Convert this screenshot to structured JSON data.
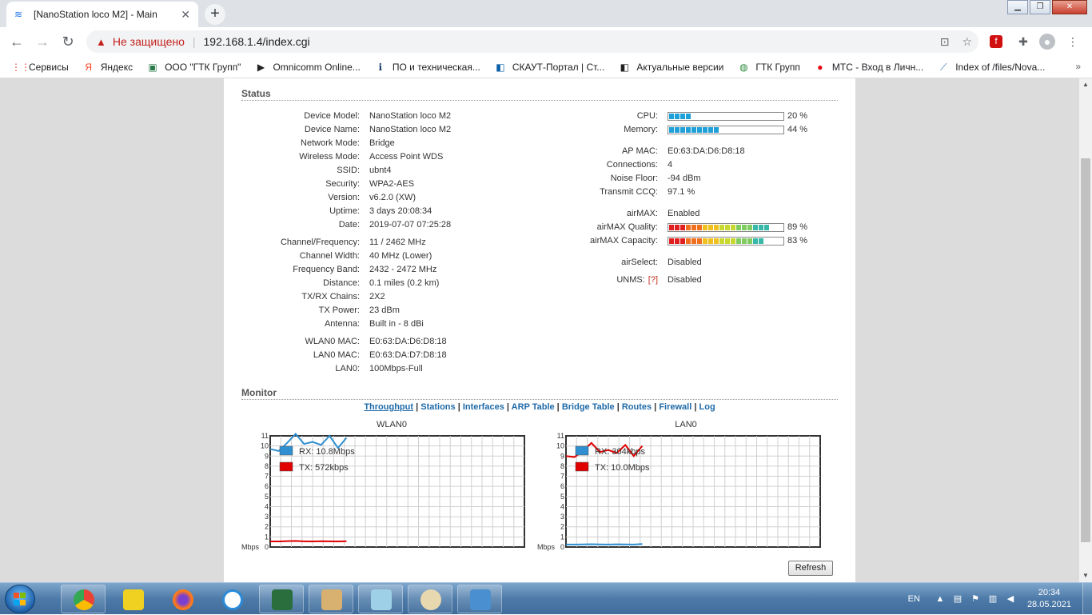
{
  "browser": {
    "tab_title": "[NanoStation loco M2] - Main",
    "tab_close": "✕",
    "new_tab": "+",
    "insecure_label": "Не защищено",
    "url": "192.168.1.4/index.cgi",
    "bookmarks": [
      {
        "label": "Сервисы",
        "icon": "apps-grid-icon",
        "glyph": "⋮⋮",
        "color": "#ea4335"
      },
      {
        "label": "Яндекс",
        "icon": "yandex-icon",
        "glyph": "Я",
        "color": "#fc3f1d"
      },
      {
        "label": "ООО \"ГТК Групп\"",
        "icon": "gtk-logo-icon",
        "glyph": "▣",
        "color": "#2b7a4b"
      },
      {
        "label": "Omnicomm Online...",
        "icon": "omnicomm-icon",
        "glyph": "▶",
        "color": "#222222"
      },
      {
        "label": "ПО и техническая...",
        "icon": "info-icon",
        "glyph": "ℹ",
        "color": "#1a3a6b"
      },
      {
        "label": "СКАУТ-Портал | Ст...",
        "icon": "scout-icon",
        "glyph": "◧",
        "color": "#0b5fa8"
      },
      {
        "label": "Актуальные версии",
        "icon": "versions-icon",
        "glyph": "◧",
        "color": "#222222"
      },
      {
        "label": "ГТК Групп",
        "icon": "gtk-group-icon",
        "glyph": "◍",
        "color": "#2c8a3e"
      },
      {
        "label": "МТС - Вход в Личн...",
        "icon": "mts-icon",
        "glyph": "●",
        "color": "#e30611"
      },
      {
        "label": "Index of /files/Nova...",
        "icon": "nova-icon",
        "glyph": "⟋",
        "color": "#3a6fb0"
      }
    ],
    "bookmarks_more": "»"
  },
  "status": {
    "title": "Status",
    "left": [
      {
        "k": "Device Model:",
        "v": "NanoStation loco M2"
      },
      {
        "k": "Device Name:",
        "v": "NanoStation loco M2"
      },
      {
        "k": "Network Mode:",
        "v": "Bridge"
      },
      {
        "k": "Wireless Mode:",
        "v": "Access Point WDS"
      },
      {
        "k": "SSID:",
        "v": "ubnt4"
      },
      {
        "k": "Security:",
        "v": "WPA2-AES"
      },
      {
        "k": "Version:",
        "v": "v6.2.0 (XW)"
      },
      {
        "k": "Uptime:",
        "v": "3 days 20:08:34"
      },
      {
        "k": "Date:",
        "v": "2019-07-07 07:25:28"
      },
      {
        "k": "Channel/Frequency:",
        "v": "11 / 2462 MHz"
      },
      {
        "k": "Channel Width:",
        "v": "40 MHz (Lower)"
      },
      {
        "k": "Frequency Band:",
        "v": "2432 - 2472 MHz"
      },
      {
        "k": "Distance:",
        "v": "0.1 miles (0.2 km)"
      },
      {
        "k": "TX/RX Chains:",
        "v": "2X2"
      },
      {
        "k": "TX Power:",
        "v": "23 dBm"
      },
      {
        "k": "Antenna:",
        "v": "Built in - 8 dBi"
      },
      {
        "k": "WLAN0 MAC:",
        "v": "E0:63:DA:D6:D8:18"
      },
      {
        "k": "LAN0 MAC:",
        "v": "E0:63:DA:D7:D8:18"
      },
      {
        "k": "LAN0:",
        "v": "100Mbps-Full"
      }
    ],
    "cpu": {
      "k": "CPU:",
      "pct": "20 %",
      "level": 0.2
    },
    "memory": {
      "k": "Memory:",
      "pct": "44 %",
      "level": 0.44
    },
    "right": [
      {
        "k": "AP MAC:",
        "v": "E0:63:DA:D6:D8:18"
      },
      {
        "k": "Connections:",
        "v": "4"
      },
      {
        "k": "Noise Floor:",
        "v": "-94 dBm"
      },
      {
        "k": "Transmit CCQ:",
        "v": "97.1 %"
      },
      {
        "k": "airMAX:",
        "v": "Enabled"
      }
    ],
    "airmax_quality": {
      "k": "airMAX Quality:",
      "pct": "89 %",
      "level": 0.89
    },
    "airmax_capacity": {
      "k": "airMAX Capacity:",
      "pct": "83 %",
      "level": 0.83
    },
    "airselect": {
      "k": "airSelect:",
      "v": "Disabled"
    },
    "unms": {
      "k": "UNMS:",
      "help": "[?]",
      "v": "Disabled"
    }
  },
  "monitor": {
    "title": "Monitor",
    "links": [
      "Throughput",
      "Stations",
      "Interfaces",
      "ARP Table",
      "Bridge Table",
      "Routes",
      "Firewall",
      "Log"
    ],
    "active_link": "Throughput",
    "refresh": "Refresh"
  },
  "chart_data": [
    {
      "type": "line",
      "title": "WLAN0",
      "ylabel": "Mbps",
      "ylim": [
        0,
        11
      ],
      "yticks": [
        "0",
        "1",
        "2",
        "3",
        "4",
        "5",
        "6",
        "7",
        "8",
        "9",
        "10",
        "11"
      ],
      "x": [
        0,
        1,
        2,
        3,
        4,
        5,
        6,
        7,
        8,
        9
      ],
      "series": [
        {
          "name": "RX: 10.8Mbps",
          "color": "#2f8fd0",
          "values": [
            9.7,
            9.5,
            10.3,
            11.2,
            10.2,
            10.4,
            10.1,
            11.0,
            9.8,
            10.8
          ]
        },
        {
          "name": "TX: 572kbps",
          "color": "#e00000",
          "values": [
            0.55,
            0.55,
            0.58,
            0.6,
            0.56,
            0.55,
            0.57,
            0.56,
            0.55,
            0.57
          ]
        }
      ]
    },
    {
      "type": "line",
      "title": "LAN0",
      "ylabel": "Mbps",
      "ylim": [
        0,
        11
      ],
      "yticks": [
        "0",
        "1",
        "2",
        "3",
        "4",
        "5",
        "6",
        "7",
        "8",
        "9",
        "10",
        "11"
      ],
      "x": [
        0,
        1,
        2,
        3,
        4,
        5,
        6,
        7,
        8,
        9
      ],
      "series": [
        {
          "name": "RX: 304kbps",
          "color": "#2f8fd0",
          "values": [
            0.25,
            0.25,
            0.26,
            0.28,
            0.26,
            0.25,
            0.27,
            0.26,
            0.25,
            0.3
          ]
        },
        {
          "name": "TX: 10.0Mbps",
          "color": "#e00000",
          "values": [
            9.0,
            8.9,
            9.5,
            10.3,
            9.4,
            9.6,
            9.3,
            10.1,
            9.0,
            10.0
          ]
        }
      ]
    }
  ],
  "taskbar": {
    "lang": "EN",
    "time": "20:34",
    "date": "28.05.2021"
  }
}
